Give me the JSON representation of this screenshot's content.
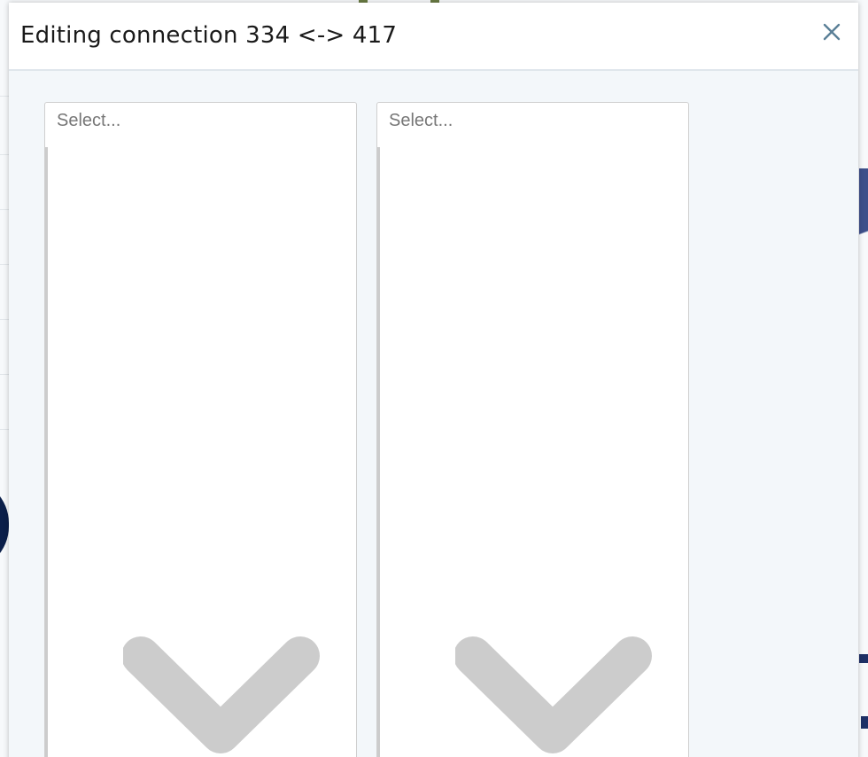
{
  "modal": {
    "title": "Editing connection 334 <-> 417",
    "close_label": "×"
  },
  "selects": [
    {
      "placeholder": "Select...",
      "value": ""
    },
    {
      "placeholder": "Select...",
      "value": ""
    }
  ],
  "icons": {
    "close": "close-icon",
    "dropdown": "chevron-down-icon"
  },
  "colors": {
    "modal_body": "#f3f7fa",
    "header_bg": "#ffffff",
    "close_icon": "#5a7f97",
    "chevron": "#cccccc",
    "placeholder_text": "#777777"
  }
}
